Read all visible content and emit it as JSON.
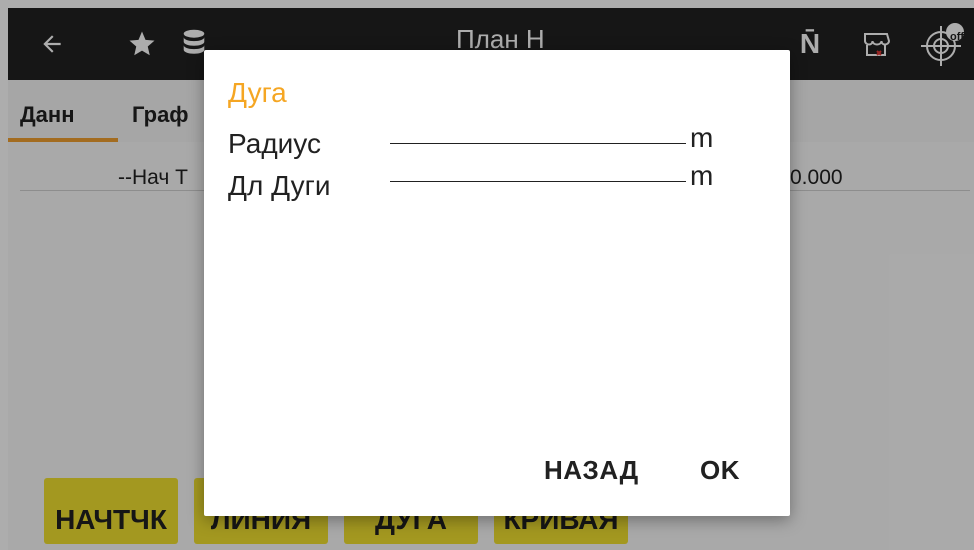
{
  "topbar": {
    "title": "План Н",
    "back_icon": "arrow-left-icon",
    "star_icon": "star-icon",
    "database_icon": "database-icon",
    "n_glyph": "N̄",
    "store_icon": "store-icon",
    "gps_icon": "gps-crosshair-icon",
    "gps_badge": "off"
  },
  "tabs": [
    {
      "label": "Данн"
    },
    {
      "label": "Граф"
    }
  ],
  "row": {
    "left": "--Нач Т",
    "right": "0.000"
  },
  "bottom_buttons": [
    {
      "label": "НАЧТЧК"
    },
    {
      "label": "ЛИНИЯ"
    },
    {
      "label": "ДУГА"
    },
    {
      "label": "КРИВАЯ"
    }
  ],
  "dialog": {
    "title": "Дуга",
    "fields": [
      {
        "label": "Радиус",
        "value": "",
        "unit": "m"
      },
      {
        "label": "Дл Дуги",
        "value": "",
        "unit": "m"
      }
    ],
    "back_label": "НАЗАД",
    "ok_label": "OK"
  },
  "colors": {
    "accent": "#f5a623",
    "topbar": "#212121",
    "button_yellow": "#f0e030"
  }
}
